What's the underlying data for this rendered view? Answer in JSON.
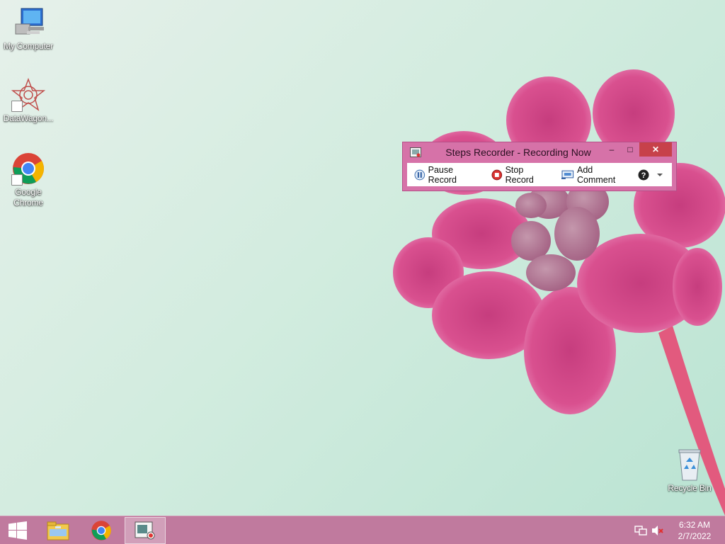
{
  "desktop": {
    "icons": [
      {
        "label": "My Computer",
        "icon": "computer-icon"
      },
      {
        "label": "DataWagon...",
        "icon": "datawagon-icon"
      },
      {
        "label": "Google Chrome",
        "icon": "chrome-icon"
      },
      {
        "label": "Recycle Bin",
        "icon": "recycle-bin-icon"
      }
    ]
  },
  "steps_recorder": {
    "title": "Steps Recorder - Recording Now",
    "pause_label": "Pause Record",
    "stop_label": "Stop Record",
    "comment_label": "Add Comment",
    "help_icon": "help-icon",
    "minimize_glyph": "–",
    "maximize_glyph": "□",
    "close_glyph": "✕"
  },
  "taskbar": {
    "items": [
      "start-icon",
      "file-explorer-icon",
      "chrome-icon",
      "steps-recorder-icon"
    ],
    "clock_time": "6:32 AM",
    "clock_date": "2/7/2022"
  },
  "colors": {
    "taskbar": "#c07a9e",
    "window_frame": "#d672a8",
    "close_button": "#c7414a"
  }
}
